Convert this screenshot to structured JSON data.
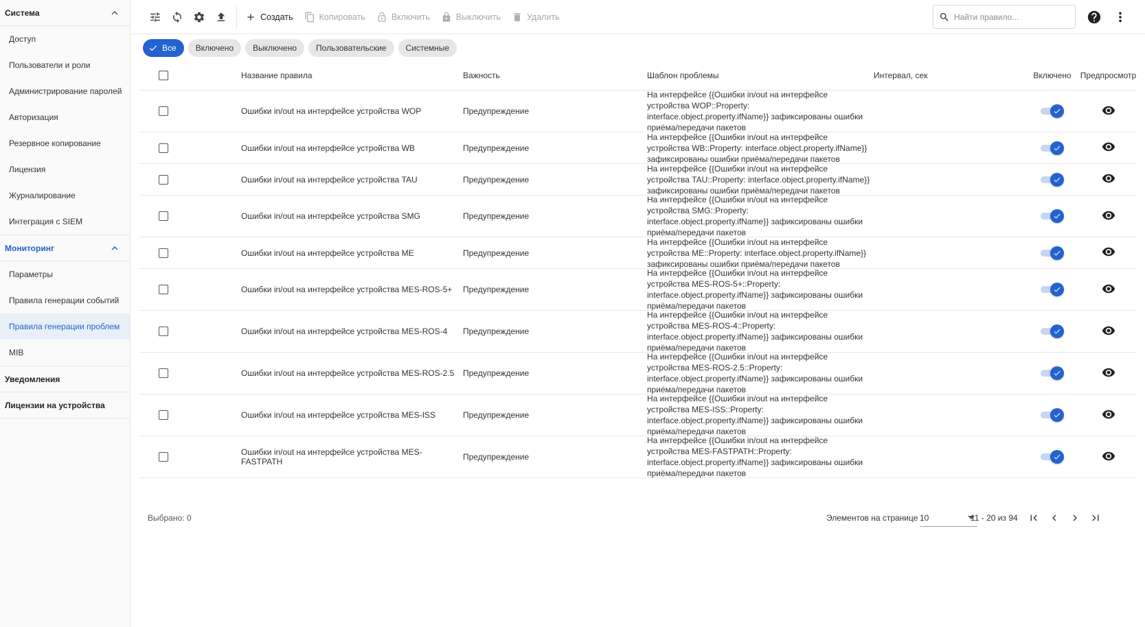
{
  "sidebar": {
    "groups": [
      {
        "label": "Система",
        "items": [
          "Доступ",
          "Пользователи и роли",
          "Администрирование паролей",
          "Авторизация",
          "Резервное копирование",
          "Лицензия",
          "Журналирование",
          "Интеграция с SIEM"
        ]
      },
      {
        "label": "Мониторинг",
        "items": [
          "Параметры",
          "Правила генерации событий",
          "Правила генерации проблем",
          "MIB"
        ]
      },
      {
        "label": "Уведомления"
      },
      {
        "label": "Лицензии на устройства"
      }
    ]
  },
  "toolbar": {
    "create": "Создать",
    "copy": "Копировать",
    "enable": "Включить",
    "disable": "Выключить",
    "delete": "Удалить",
    "search_placeholder": "Найти правило..."
  },
  "filters": [
    "Все",
    "Включено",
    "Выключено",
    "Пользовательские",
    "Системные"
  ],
  "table": {
    "columns": {
      "name": "Название правила",
      "severity": "Важность",
      "template": "Шаблон проблемы",
      "interval": "Интервал, сек",
      "enabled": "Включено",
      "preview": "Предпросмотр"
    },
    "rows": [
      {
        "name": "Ошибки in/out на интерфейсе устройства WOP",
        "severity": "Предупреждение",
        "template": [
          "На интерфейсе {{Ошибки in/out на интерфейсе",
          "устройства WOP::Property:",
          "interface.object.property.ifName}} зафиксированы ошибки",
          "приёма/передачи пакетов"
        ]
      },
      {
        "name": "Ошибки in/out на интерфейсе устройства WB",
        "severity": "Предупреждение",
        "template": [
          "На интерфейсе {{Ошибки in/out на интерфейсе",
          "устройства WB::Property: interface.object.property.ifName}}",
          "зафиксированы ошибки приёма/передачи пакетов"
        ]
      },
      {
        "name": "Ошибки in/out на интерфейсе устройства TAU",
        "severity": "Предупреждение",
        "template": [
          "На интерфейсе {{Ошибки in/out на интерфейсе",
          "устройства TAU::Property: interface.object.property.ifName}}",
          "зафиксированы ошибки приёма/передачи пакетов"
        ]
      },
      {
        "name": "Ошибки in/out на интерфейсе устройства SMG",
        "severity": "Предупреждение",
        "template": [
          "На интерфейсе {{Ошибки in/out на интерфейсе",
          "устройства SMG::Property:",
          "interface.object.property.ifName}} зафиксированы ошибки",
          "приёма/передачи пакетов"
        ]
      },
      {
        "name": "Ошибки in/out на интерфейсе устройства ME",
        "severity": "Предупреждение",
        "template": [
          "На интерфейсе {{Ошибки in/out на интерфейсе",
          "устройства ME::Property: interface.object.property.ifName}}",
          "зафиксированы ошибки приёма/передачи пакетов"
        ]
      },
      {
        "name": "Ошибки in/out на интерфейсе устройства MES-ROS-5+",
        "severity": "Предупреждение",
        "template": [
          "На интерфейсе {{Ошибки in/out на интерфейсе",
          "устройства MES-ROS-5+::Property:",
          "interface.object.property.ifName}} зафиксированы ошибки",
          "приёма/передачи пакетов"
        ]
      },
      {
        "name": "Ошибки in/out на интерфейсе устройства MES-ROS-4",
        "severity": "Предупреждение",
        "template": [
          "На интерфейсе {{Ошибки in/out на интерфейсе",
          "устройства MES-ROS-4::Property:",
          "interface.object.property.ifName}} зафиксированы ошибки",
          "приёма/передачи пакетов"
        ]
      },
      {
        "name": "Ошибки in/out на интерфейсе устройства MES-ROS-2.5",
        "severity": "Предупреждение",
        "template": [
          "На интерфейсе {{Ошибки in/out на интерфейсе",
          "устройства MES-ROS-2.5::Property:",
          "interface.object.property.ifName}} зафиксированы ошибки",
          "приёма/передачи пакетов"
        ]
      },
      {
        "name": "Ошибки in/out на интерфейсе устройства MES-ISS",
        "severity": "Предупреждение",
        "template": [
          "На интерфейсе {{Ошибки in/out на интерфейсе",
          "устройства MES-ISS::Property:",
          "interface.object.property.ifName}} зафиксированы ошибки",
          "приёма/передачи пакетов"
        ]
      },
      {
        "name": "Ошибки in/out на интерфейсе устройства MES-FASTPATH",
        "severity": "Предупреждение",
        "template": [
          "На интерфейсе {{Ошибки in/out на интерфейсе",
          "устройства MES-FASTPATH::Property:",
          "interface.object.property.ifName}} зафиксированы ошибки",
          "приёма/передачи пакетов"
        ]
      }
    ]
  },
  "footer": {
    "selected": "Выбрано: 0",
    "per_page_label": "Элементов на странице",
    "per_page_value": "10",
    "range": "11 - 20 из 94"
  },
  "colors": {
    "accent": "#2463cf",
    "active_bg": "#e8eff9"
  },
  "icons": [
    "filter-settings-icon",
    "refresh-icon",
    "gear-icon",
    "upload-icon",
    "plus-icon",
    "copy-icon",
    "lock-icon",
    "unlock-icon",
    "trash-icon",
    "search-icon",
    "help-icon",
    "more-vert-icon",
    "check-icon",
    "eye-icon",
    "first-page-icon",
    "prev-page-icon",
    "next-page-icon",
    "last-page-icon",
    "chevron-up-icon"
  ]
}
